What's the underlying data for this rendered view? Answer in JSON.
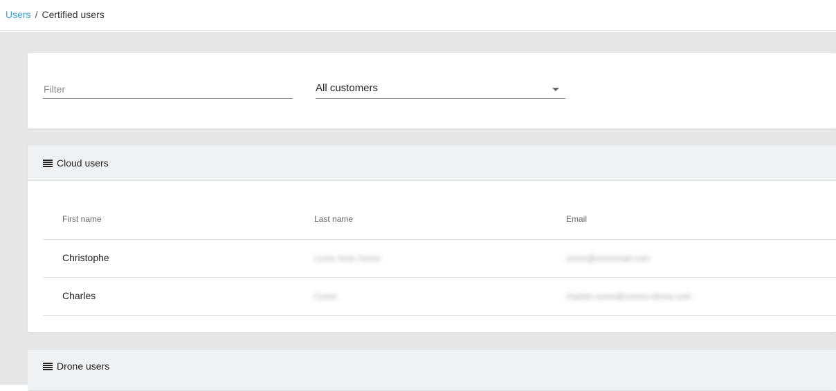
{
  "breadcrumb": {
    "parent": "Users",
    "separator": "/",
    "current": "Certified users"
  },
  "filter": {
    "placeholder": "Filter",
    "value": ""
  },
  "customer_select": {
    "selected": "All customers",
    "icon": "caret-down-icon"
  },
  "cloud_users": {
    "title": "Cloud users",
    "icon": "list-icon",
    "columns": {
      "first_name": "First name",
      "last_name": "Last name",
      "email": "Email"
    },
    "rows": [
      {
        "first_name": "Christophe",
        "last_name": "Lxxxx Xxxx Xxxxx",
        "email": "xxxxx@xxxxxmail.com"
      },
      {
        "first_name": "Charles",
        "last_name": "Cxxxx",
        "email": "charles.xxxxx@xxxxxx-drone.com"
      }
    ]
  },
  "drone_users": {
    "title": "Drone users",
    "icon": "list-icon"
  },
  "colors": {
    "link": "#3a9fd5",
    "page_bg": "#e5e6e8",
    "card_header_bg": "#eff2f5"
  }
}
